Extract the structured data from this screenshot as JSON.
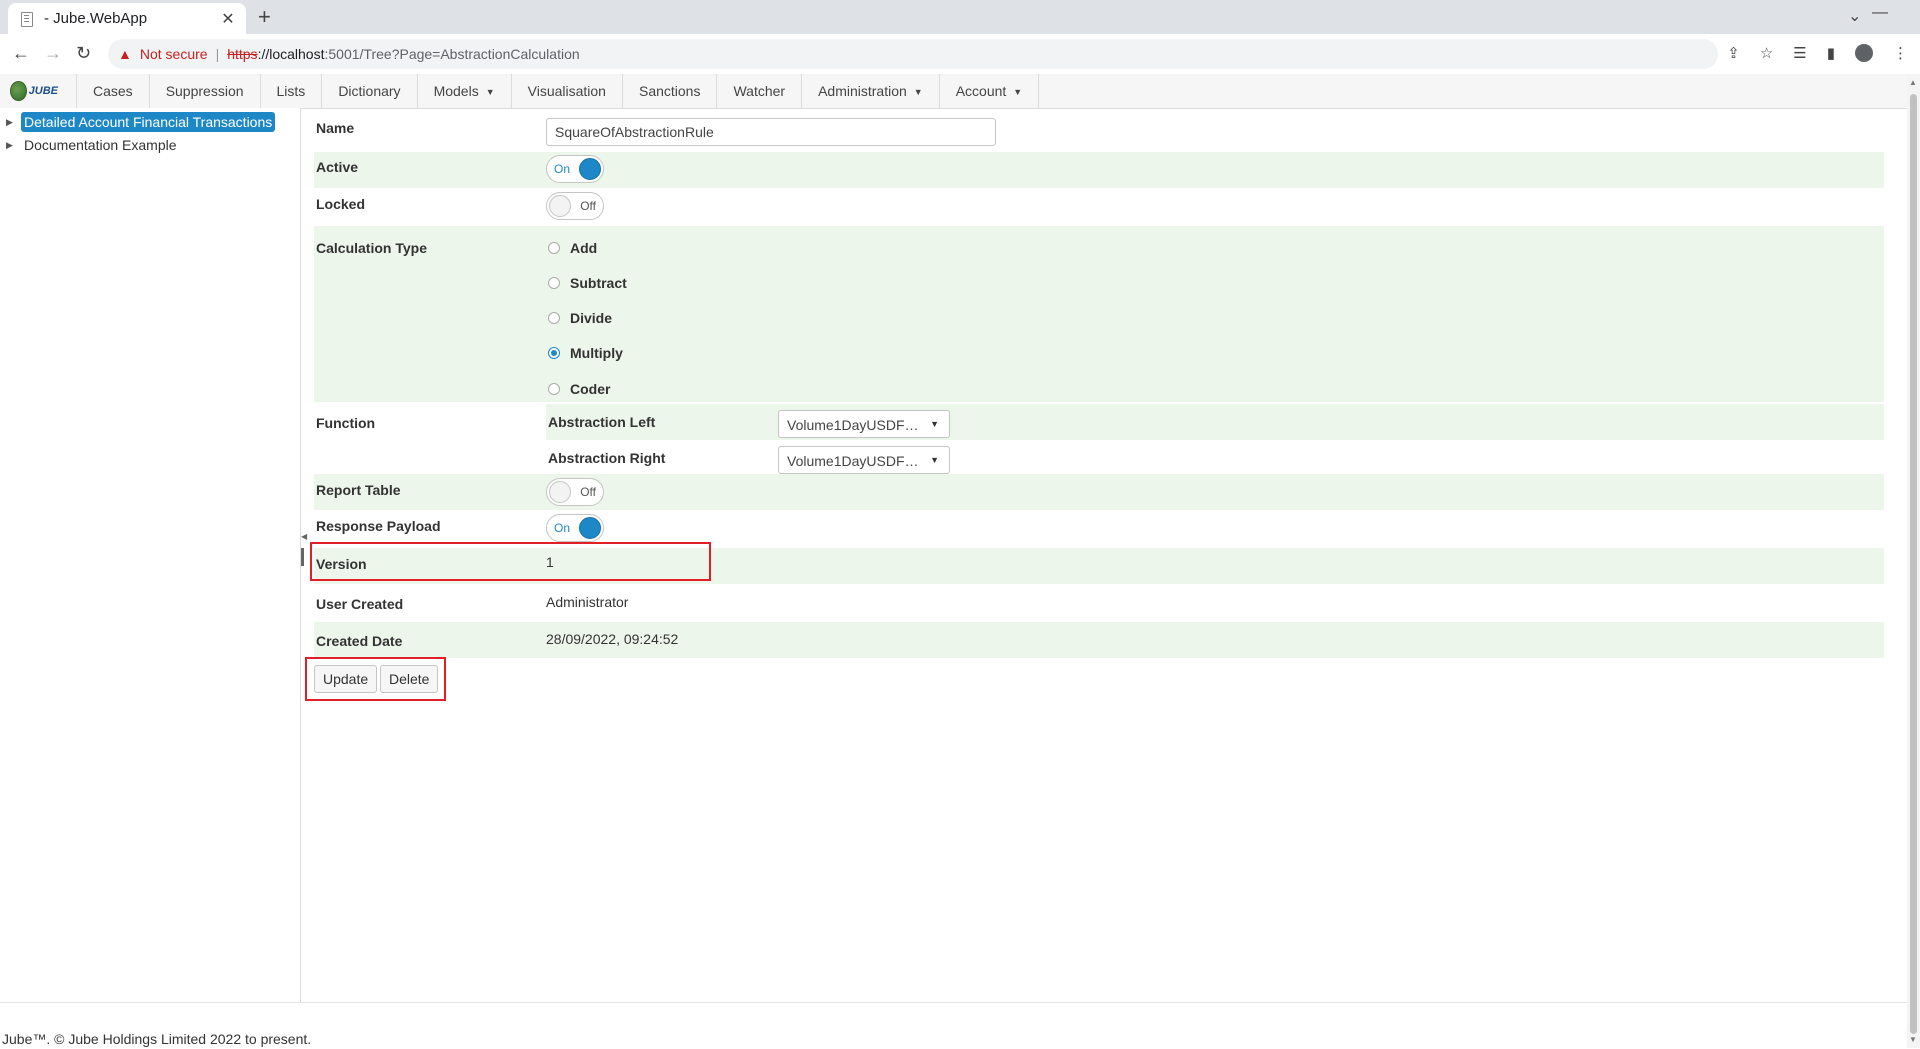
{
  "browser": {
    "tab_title": "- Jube.WebApp",
    "security_label": "Not secure",
    "url_scheme": "https",
    "url_host": "://localhost",
    "url_rest": ":5001/Tree?Page=AbstractionCalculation"
  },
  "app": {
    "logo_text": "JUBE",
    "menu": [
      {
        "label": "Cases"
      },
      {
        "label": "Suppression"
      },
      {
        "label": "Lists"
      },
      {
        "label": "Dictionary"
      },
      {
        "label": "Models",
        "dropdown": true
      },
      {
        "label": "Visualisation"
      },
      {
        "label": "Sanctions"
      },
      {
        "label": "Watcher"
      },
      {
        "label": "Administration",
        "dropdown": true
      },
      {
        "label": "Account",
        "dropdown": true
      }
    ],
    "tree": [
      {
        "label": "Detailed Account Financial Transactions",
        "selected": true
      },
      {
        "label": "Documentation Example",
        "selected": false
      }
    ]
  },
  "form": {
    "name_label": "Name",
    "name_value": "SquareOfAbstractionRule",
    "active_label": "Active",
    "active_state": "On",
    "locked_label": "Locked",
    "locked_state": "Off",
    "calc_type_label": "Calculation Type",
    "calc_types": [
      {
        "label": "Add",
        "checked": false
      },
      {
        "label": "Subtract",
        "checked": false
      },
      {
        "label": "Divide",
        "checked": false
      },
      {
        "label": "Multiply",
        "checked": true
      },
      {
        "label": "Coder",
        "checked": false
      }
    ],
    "function_label": "Function",
    "abstraction_left_label": "Abstraction Left",
    "abstraction_left_value": "Volume1DayUSDF…",
    "abstraction_right_label": "Abstraction Right",
    "abstraction_right_value": "Volume1DayUSDF…",
    "report_table_label": "Report Table",
    "report_table_state": "Off",
    "response_payload_label": "Response Payload",
    "response_payload_state": "On",
    "version_label": "Version",
    "version_value": "1",
    "user_created_label": "User Created",
    "user_created_value": "Administrator",
    "created_date_label": "Created Date",
    "created_date_value": "28/09/2022, 09:24:52",
    "update_button": "Update",
    "delete_button": "Delete"
  },
  "footer": {
    "text": "Jube™. © Jube Holdings Limited 2022 to present."
  },
  "colors": {
    "accent": "#1e88c7",
    "row_alt": "#edf6ea",
    "highlight": "#e01f26"
  }
}
